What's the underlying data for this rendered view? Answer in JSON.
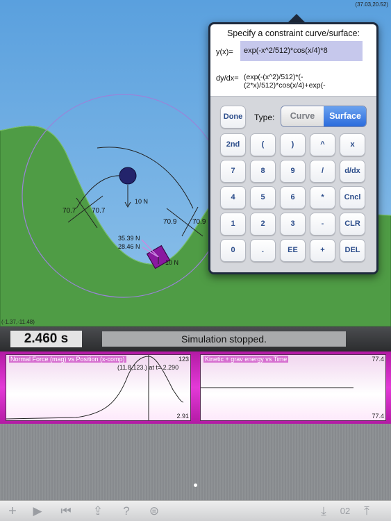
{
  "scene": {
    "corner_top_right": "(37.03,20.52)",
    "corner_bottom_left": "(-1.37,-11.48)",
    "labels": {
      "force_10n_top": "10 N",
      "angle_left_1": "70.7",
      "angle_left_2": "70.7",
      "angle_right_1": "70.9",
      "angle_right_2": "70.9",
      "force_a": "35.39 N",
      "force_b": "28.46 N",
      "force_10n_bottom": "10 N"
    },
    "colors": {
      "sky": "#6aaae2",
      "hill": "#4f9c45",
      "ball": "#23246b",
      "block": "#8a19a0",
      "orbit": "#9a83d9"
    }
  },
  "status": {
    "time": "2.460 s",
    "message": "Simulation stopped."
  },
  "graphs": [
    {
      "title": "Normal Force (mag) vs Position (x-comp)",
      "max": "123",
      "min": "2.91",
      "cursor": "(11.8,123.) at t= 2.290"
    },
    {
      "title": "Kinetic + grav energy vs Time",
      "max": "77.4",
      "min": "77.4"
    }
  ],
  "popover": {
    "title": "Specify a constraint curve/surface:",
    "yx_label": "y(x)=",
    "yx_value": "exp(-x^2/512)*cos(x/4)*8",
    "dydx_label": "dy/dx=",
    "dydx_value": "(exp(-(x^2)/512)*(-(2*x)/512)*cos(x/4)+exp(-",
    "done_label": "Done",
    "type_label": "Type:",
    "segment": {
      "curve": "Curve",
      "surface": "Surface",
      "selected": "Surface"
    },
    "keys": [
      "2nd",
      "(",
      ")",
      "^",
      "x",
      "7",
      "8",
      "9",
      "/",
      "d/dx",
      "4",
      "5",
      "6",
      "*",
      "Cncl",
      "1",
      "2",
      "3",
      "-",
      "CLR",
      "0",
      ".",
      "EE",
      "+",
      "DEL"
    ]
  },
  "toolbar": {
    "icons": [
      "plus-icon",
      "play-icon",
      "rewind-icon",
      "share-icon",
      "help-icon",
      "menu-icon",
      "download-icon",
      "upload-icon"
    ],
    "page_number": "02"
  }
}
